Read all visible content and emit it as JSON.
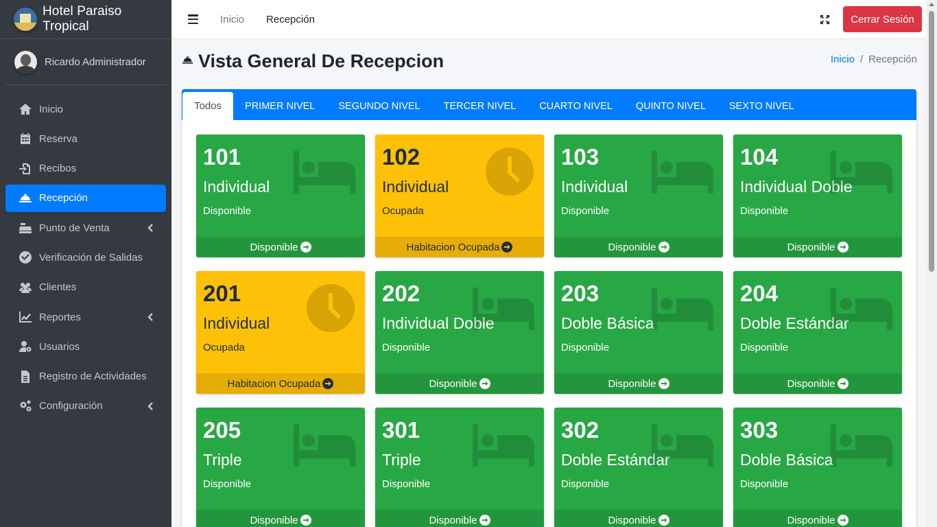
{
  "brand": {
    "name": "Hotel Paraiso Tropical"
  },
  "user": {
    "name": "Ricardo Administrador"
  },
  "sidebar": {
    "items": [
      {
        "label": "Inicio",
        "icon": "home-icon"
      },
      {
        "label": "Reserva",
        "icon": "calendar-icon"
      },
      {
        "label": "Recibos",
        "icon": "file-import-icon"
      },
      {
        "label": "Recepción",
        "icon": "concierge-bell-icon",
        "active": true
      },
      {
        "label": "Punto de Venta",
        "icon": "cash-register-icon",
        "has_submenu": true
      },
      {
        "label": "Verificación de Salidas",
        "icon": "check-circle-icon"
      },
      {
        "label": "Clientes",
        "icon": "users-icon"
      },
      {
        "label": "Reportes",
        "icon": "chart-line-icon",
        "has_submenu": true
      },
      {
        "label": "Usuarios",
        "icon": "user-cog-icon"
      },
      {
        "label": "Registro de Actividades",
        "icon": "file-alt-icon"
      },
      {
        "label": "Configuración",
        "icon": "cogs-icon",
        "has_submenu": true
      }
    ]
  },
  "topbar": {
    "links": [
      "Inicio",
      "Recepción"
    ],
    "logout_label": "Cerrar Sesión"
  },
  "header": {
    "title": "Vista General De Recepcion",
    "breadcrumb": {
      "home": "Inicio",
      "separator": "/",
      "current": "Recepción"
    }
  },
  "tabs": [
    "Todos",
    "PRIMER NIVEL",
    "SEGUNDO NIVEL",
    "TERCER NIVEL",
    "CUARTO NIVEL",
    "QUINTO NIVEL",
    "SEXTO NIVEL"
  ],
  "rooms": [
    {
      "number": "101",
      "type": "Individual",
      "status": "Disponible",
      "action": "Disponible",
      "state": "available"
    },
    {
      "number": "102",
      "type": "Individual",
      "status": "Ocupada",
      "action": "Habitacion Ocupada",
      "state": "occupied"
    },
    {
      "number": "103",
      "type": "Individual",
      "status": "Disponible",
      "action": "Disponible",
      "state": "available"
    },
    {
      "number": "104",
      "type": "Individual Doble",
      "status": "Disponible",
      "action": "Disponible",
      "state": "available"
    },
    {
      "number": "201",
      "type": "Individual",
      "status": "Ocupada",
      "action": "Habitacion Ocupada",
      "state": "occupied"
    },
    {
      "number": "202",
      "type": "Individual Doble",
      "status": "Disponible",
      "action": "Disponible",
      "state": "available"
    },
    {
      "number": "203",
      "type": "Doble Básica",
      "status": "Disponible",
      "action": "Disponible",
      "state": "available"
    },
    {
      "number": "204",
      "type": "Doble Estándar",
      "status": "Disponible",
      "action": "Disponible",
      "state": "available"
    },
    {
      "number": "205",
      "type": "Triple",
      "status": "Disponible",
      "action": "Disponible",
      "state": "available"
    },
    {
      "number": "301",
      "type": "Triple",
      "status": "Disponible",
      "action": "Disponible",
      "state": "available"
    },
    {
      "number": "302",
      "type": "Doble Estándar",
      "status": "Disponible",
      "action": "Disponible",
      "state": "available"
    },
    {
      "number": "303",
      "type": "Doble Básica",
      "status": "Disponible",
      "action": "Disponible",
      "state": "available"
    }
  ],
  "colors": {
    "sidebar_bg": "#343a40",
    "primary": "#007bff",
    "available": "#28a745",
    "occupied": "#ffc107",
    "danger": "#dc3545"
  }
}
